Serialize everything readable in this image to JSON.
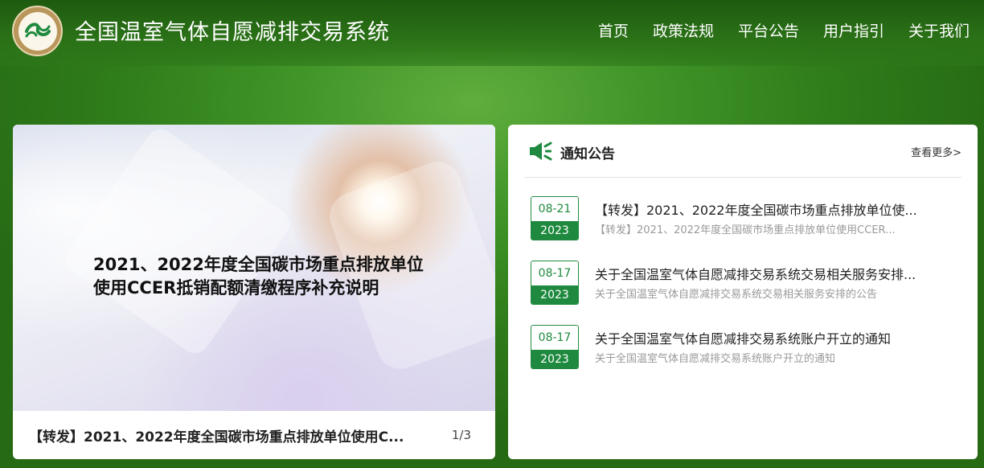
{
  "header": {
    "site_title": "全国温室气体自愿减排交易系统",
    "logo_icon": "emblem-logo",
    "nav": [
      {
        "label": "首页"
      },
      {
        "label": "政策法规"
      },
      {
        "label": "平台公告"
      },
      {
        "label": "用户指引"
      },
      {
        "label": "关于我们"
      }
    ]
  },
  "banner": {
    "headline_line1": "2021、2022年度全国碳市场重点排放单位",
    "headline_line2": "使用CCER抵销配额清缴程序补充说明",
    "caption": "【转发】2021、2022年度全国碳市场重点排放单位使用C...",
    "pager": "1/3"
  },
  "notice": {
    "title": "通知公告",
    "more": "查看更多>",
    "icon": "speaker-icon",
    "accent_color": "#1f8a3f",
    "items": [
      {
        "date_md": "08-21",
        "date_y": "2023",
        "title": "【转发】2021、2022年度全国碳市场重点排放单位使...",
        "subtitle": "【转发】2021、2022年度全国碳市场重点排放单位使用CCER..."
      },
      {
        "date_md": "08-17",
        "date_y": "2023",
        "title": "关于全国温室气体自愿减排交易系统交易相关服务安排...",
        "subtitle": "关于全国温室气体自愿减排交易系统交易相关服务安排的公告"
      },
      {
        "date_md": "08-17",
        "date_y": "2023",
        "title": "关于全国温室气体自愿减排交易系统账户开立的通知",
        "subtitle": "关于全国温室气体自愿减排交易系统账户开立的通知"
      }
    ]
  }
}
